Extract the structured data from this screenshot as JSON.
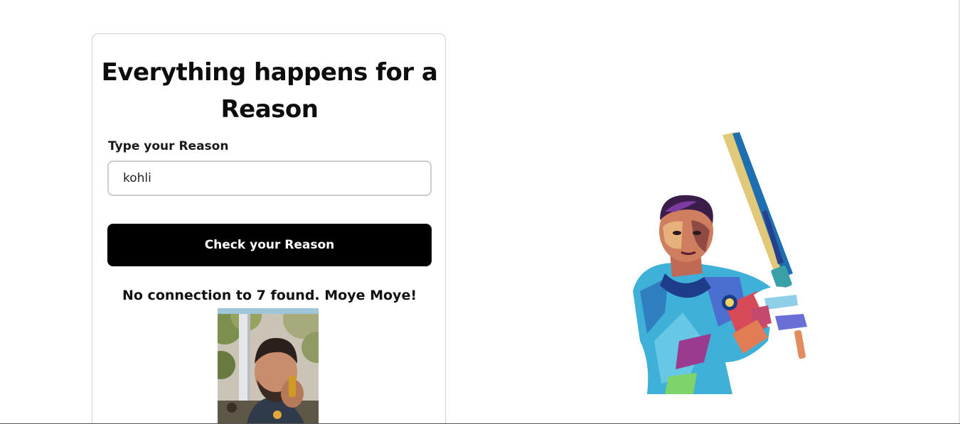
{
  "card": {
    "title": "Everything happens for a Reason",
    "input_label": "Type your Reason",
    "input_value": "kohli",
    "button_label": "Check your Reason",
    "result_text": "No connection to 7 found. Moye Moye!"
  },
  "images": {
    "result_image": "photo of a man holding a phone to his ear, trees in background",
    "hero_illustration": "colorful pop-art illustration of a cricketer in blue jersey raising a bat"
  },
  "colors": {
    "button_bg": "#000000",
    "button_text": "#ffffff",
    "card_border": "#cfcfcf",
    "input_border": "#cdcdcd"
  }
}
